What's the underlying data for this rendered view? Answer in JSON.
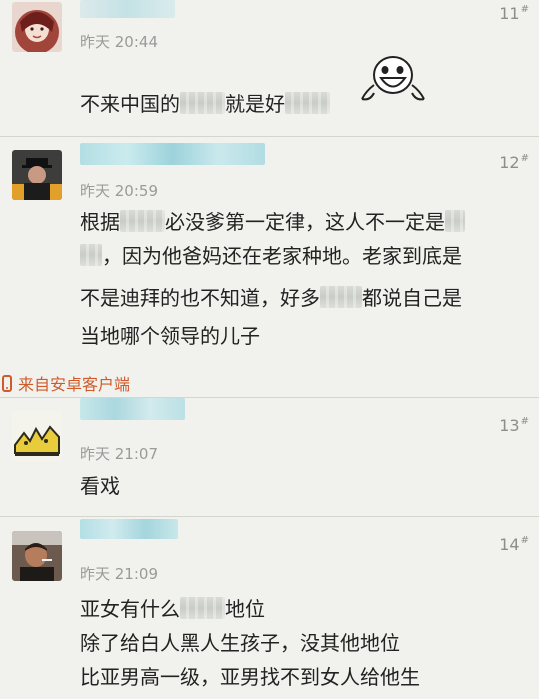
{
  "posts": [
    {
      "floor": "11",
      "floor_mark": "#",
      "time": "昨天 20:44",
      "lines": [
        [
          "不来中国的",
          "[blur]",
          "就是好",
          "[blur]"
        ]
      ]
    },
    {
      "floor": "12",
      "floor_mark": "#",
      "time": "昨天 20:59",
      "lines": [
        [
          "根据",
          "[blur]",
          "必没爹第一定律，这人不一定是",
          "[blur]"
        ],
        [
          "[blur]",
          "，因为他爸妈还在老家种地。老家到底是"
        ],
        [
          "不是迪拜的也不知道，好多",
          "[blur]",
          "都说自己是"
        ],
        [
          "当地哪个领导的儿子"
        ]
      ]
    },
    {
      "floor": "13",
      "floor_mark": "#",
      "time": "昨天 21:07",
      "lines": [
        [
          "看戏"
        ]
      ]
    },
    {
      "floor": "14",
      "floor_mark": "#",
      "time": "昨天 21:09",
      "lines": [
        [
          "亚女有什么",
          "[blur]",
          "地位"
        ],
        [
          "除了给白人黑人生孩子，没其他地位"
        ],
        [
          "比亚男高一级，亚男找不到女人给他生"
        ]
      ]
    }
  ],
  "source_label": "来自安卓客户端",
  "icons": {
    "source": "phone-icon",
    "emoji": "laughing-face-icon"
  },
  "colors": {
    "background": "#f1f2ee",
    "source_text": "#d05a2a",
    "time_text": "#9a9a9a",
    "username_blur": "#a7dbe2"
  }
}
